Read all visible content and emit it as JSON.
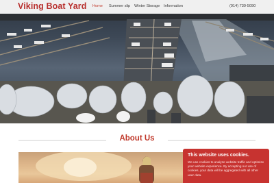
{
  "header": {
    "logo": "Viking Boat Yard",
    "nav": [
      {
        "label": "Home",
        "active": true
      },
      {
        "label": "Summer slip",
        "active": false
      },
      {
        "label": "Winter Storage",
        "active": false
      },
      {
        "label": "Information",
        "active": false
      }
    ],
    "phone": "(914) 739-5090"
  },
  "hero": {
    "image": "marina-aerial-photo"
  },
  "about": {
    "title": "About Us",
    "image": "sunset-photo"
  },
  "cookie": {
    "title": "This website uses cookies.",
    "body": "We use cookies to analyze website traffic and optimize your website experience. By accepting our use of cookies, your data will be aggregated with all other user data."
  },
  "colors": {
    "brand": "#b8312f",
    "cookie_bg": "#c73330"
  }
}
